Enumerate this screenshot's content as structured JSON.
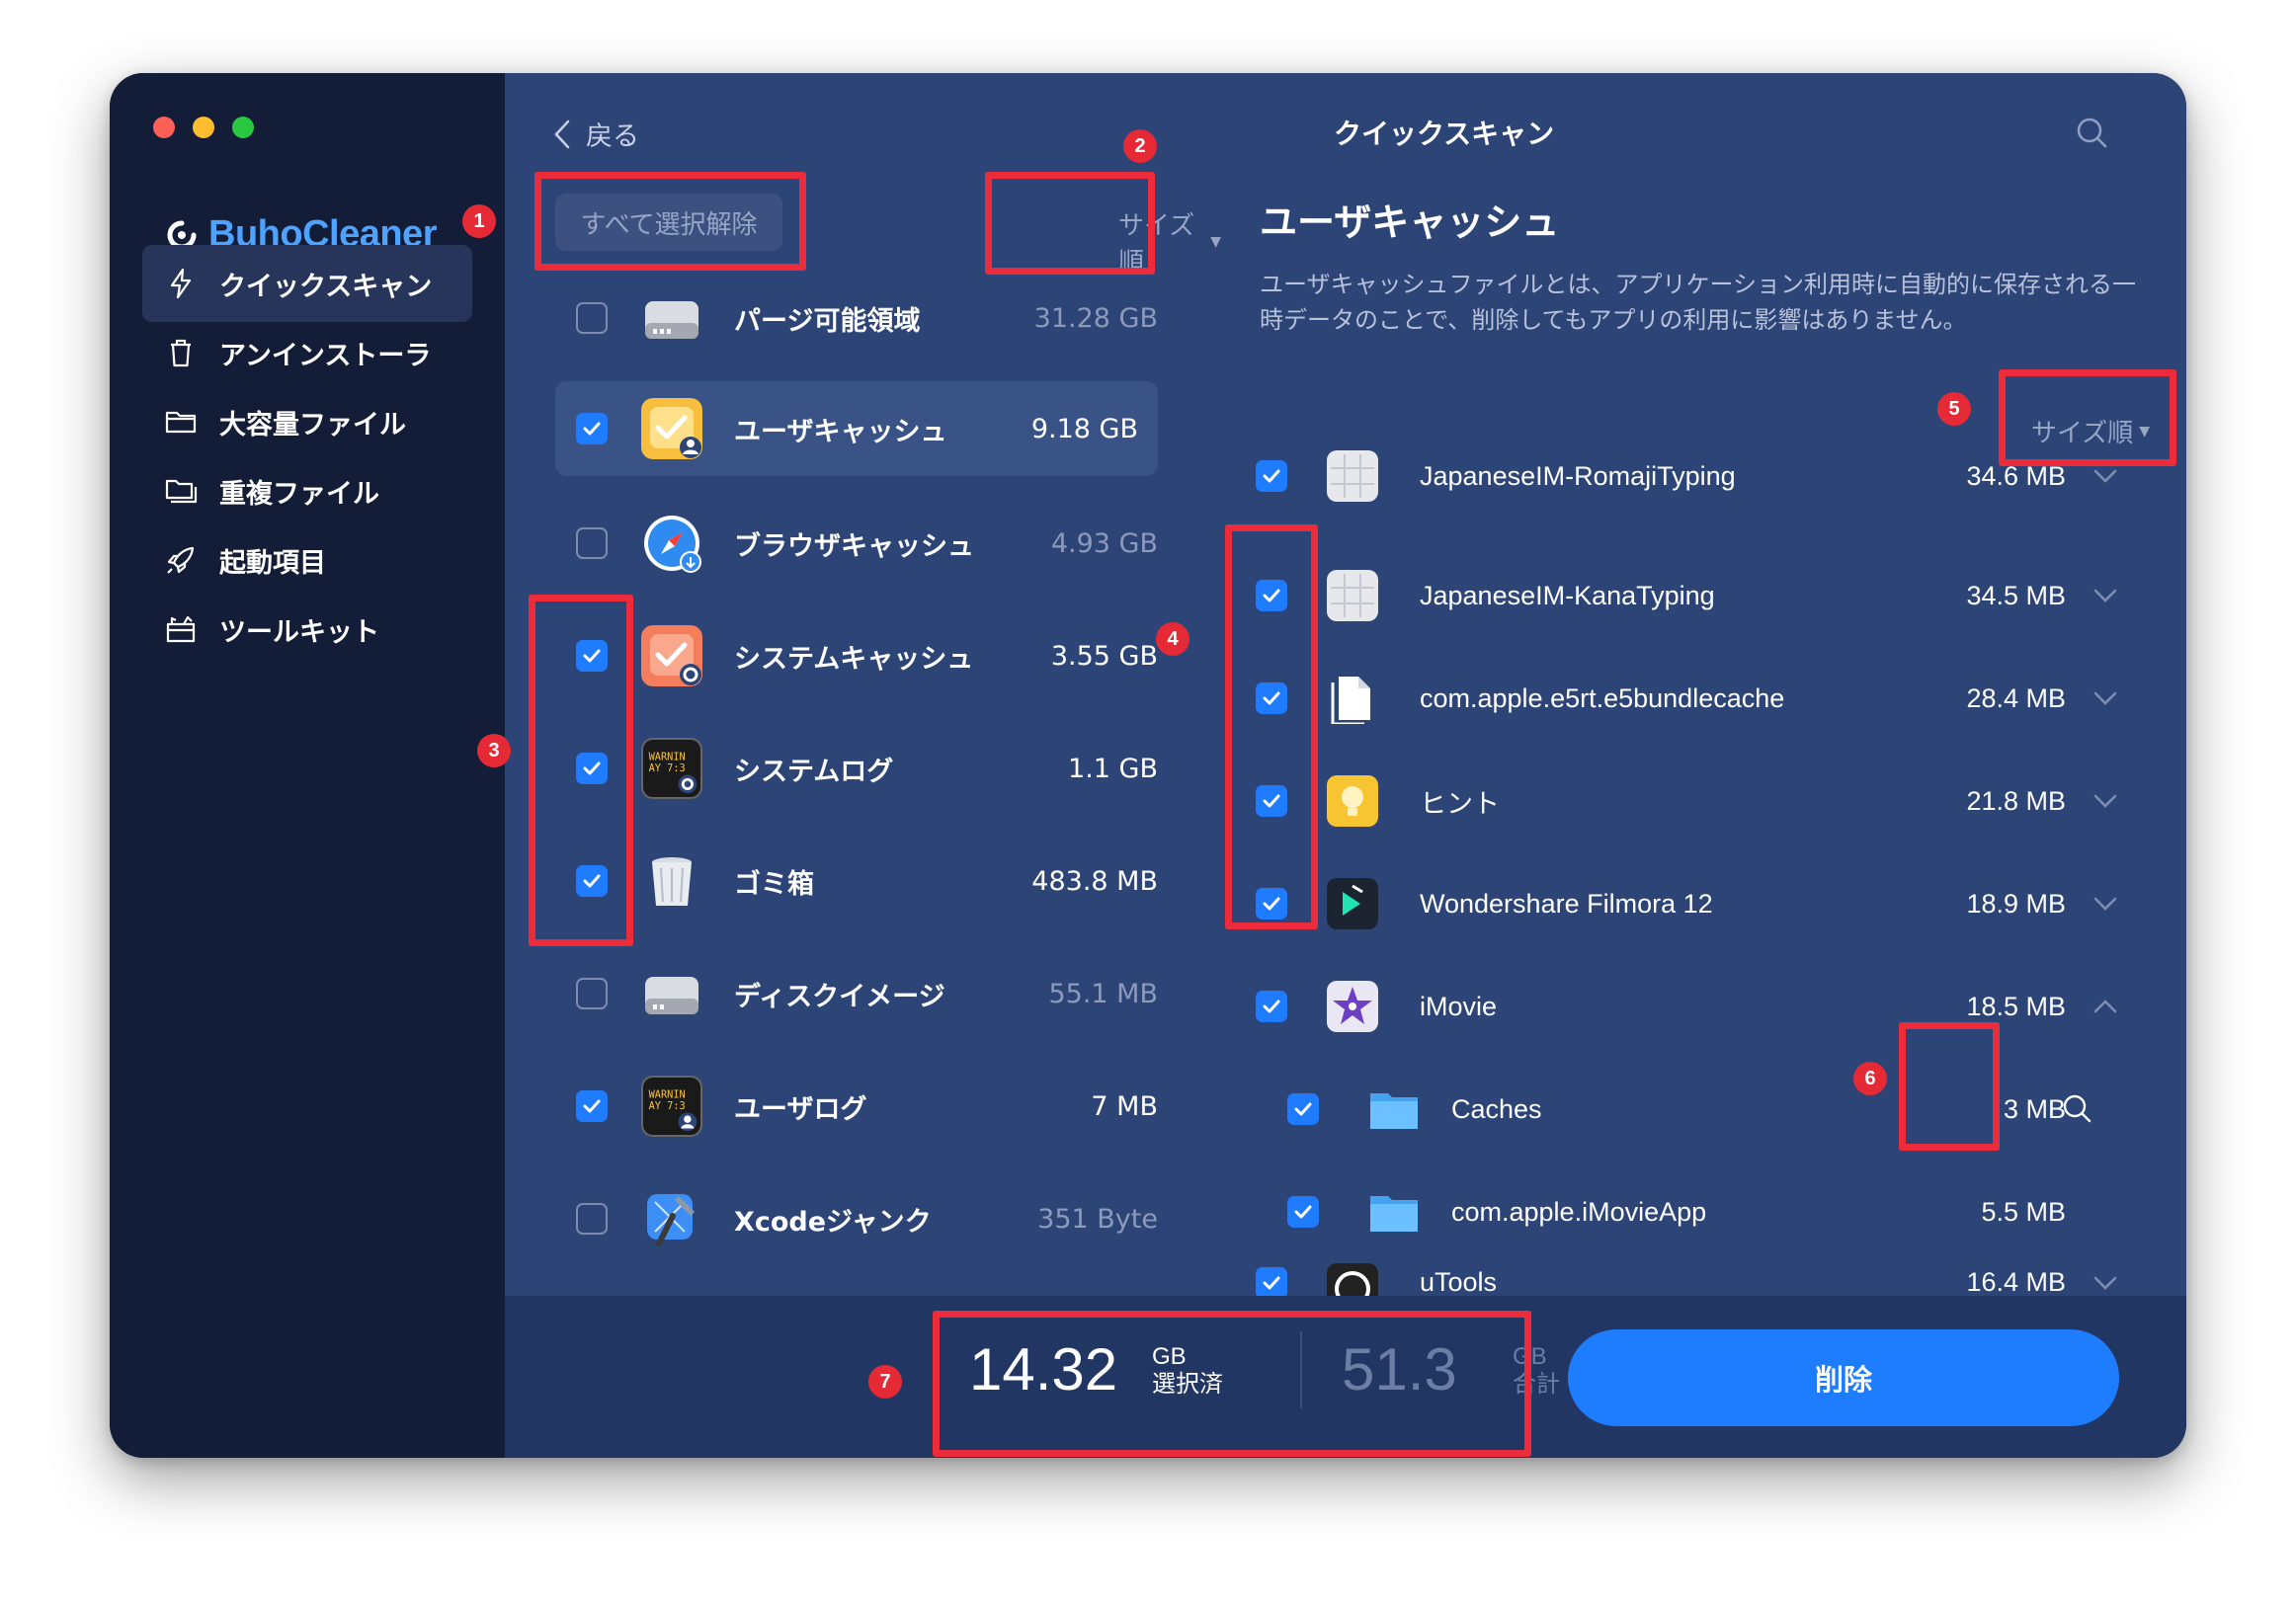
{
  "app": {
    "name": "BuhoCleaner"
  },
  "sidebar": {
    "items": [
      {
        "label": "クイックスキャン",
        "icon": "lightning-icon",
        "active": true
      },
      {
        "label": "アンインストーラ",
        "icon": "trash-icon",
        "active": false
      },
      {
        "label": "大容量ファイル",
        "icon": "folder-icon",
        "active": false
      },
      {
        "label": "重複ファイル",
        "icon": "duplicate-folder-icon",
        "active": false
      },
      {
        "label": "起動項目",
        "icon": "rocket-icon",
        "active": false
      },
      {
        "label": "ツールキット",
        "icon": "toolkit-icon",
        "active": false
      }
    ]
  },
  "middle": {
    "back_label": "戻る",
    "deselect_all_label": "すべて選択解除",
    "sort_label": "サイズ順",
    "rows": [
      {
        "label": "パージ可能領域",
        "size": "31.28 GB",
        "checked": false,
        "icon": "disk-icon"
      },
      {
        "label": "ユーザキャッシュ",
        "size": "9.18 GB",
        "checked": true,
        "icon": "user-cache-icon"
      },
      {
        "label": "ブラウザキャッシュ",
        "size": "4.93 GB",
        "checked": false,
        "icon": "safari-icon"
      },
      {
        "label": "システムキャッシュ",
        "size": "3.55 GB",
        "checked": true,
        "icon": "system-cache-icon"
      },
      {
        "label": "システムログ",
        "size": "1.1 GB",
        "checked": true,
        "icon": "console-log-icon"
      },
      {
        "label": "ゴミ箱",
        "size": "483.8 MB",
        "checked": true,
        "icon": "trash-bin-icon"
      },
      {
        "label": "ディスクイメージ",
        "size": "55.1 MB",
        "checked": false,
        "icon": "disk-image-icon"
      },
      {
        "label": "ユーザログ",
        "size": "7 MB",
        "checked": true,
        "icon": "user-log-icon"
      },
      {
        "label": "Xcodeジャンク",
        "size": "351 Byte",
        "checked": false,
        "icon": "xcode-icon"
      }
    ]
  },
  "right": {
    "title": "クイックスキャン",
    "section_title": "ユーザキャッシュ",
    "description": "ユーザキャッシュファイルとは、アプリケーション利用時に自動的に保存される一時データのことで、削除してもアプリの利用に影響はありません。",
    "sort_label": "サイズ順",
    "rows": [
      {
        "label": "JapaneseIM-RomajiTyping",
        "size": "34.6 MB",
        "checked": true,
        "icon": "keyboard-grid-icon",
        "chevron": "down"
      },
      {
        "label": "JapaneseIM-KanaTyping",
        "size": "34.5 MB",
        "checked": true,
        "icon": "keyboard-grid-icon",
        "chevron": "down"
      },
      {
        "label": "com.apple.e5rt.e5bundlecache",
        "size": "28.4 MB",
        "checked": true,
        "icon": "document-icon",
        "chevron": "down"
      },
      {
        "label": "ヒント",
        "size": "21.8 MB",
        "checked": true,
        "icon": "lightbulb-icon",
        "chevron": "down"
      },
      {
        "label": "Wondershare Filmora 12",
        "size": "18.9 MB",
        "checked": true,
        "icon": "filmora-icon",
        "chevron": "down"
      },
      {
        "label": "iMovie",
        "size": "18.5 MB",
        "checked": true,
        "icon": "imovie-star-icon",
        "chevron": "up"
      },
      {
        "label": "Caches",
        "size": "3 MB",
        "checked": true,
        "icon": "folder-icon",
        "chevron": "none",
        "child": true
      },
      {
        "label": "com.apple.iMovieApp",
        "size": "5.5 MB",
        "checked": true,
        "icon": "folder-icon",
        "chevron": "none",
        "child": true
      },
      {
        "label": "uTools",
        "size": "16.4 MB",
        "checked": true,
        "icon": "utools-icon",
        "chevron": "down"
      }
    ]
  },
  "footer": {
    "selected_value": "14.32",
    "selected_unit": "GB",
    "selected_caption": "選択済",
    "total_value": "51.3",
    "total_unit": "GB",
    "total_caption": "合計",
    "delete_label": "削除"
  },
  "annotations": [
    "1",
    "2",
    "3",
    "4",
    "5",
    "6",
    "7"
  ],
  "colors": {
    "sidebar_bg": "#141d37",
    "panel_bg": "#2d4477",
    "accent": "#1e7cff",
    "annotation": "#ec2b3b",
    "logo": "#4da3ff"
  }
}
